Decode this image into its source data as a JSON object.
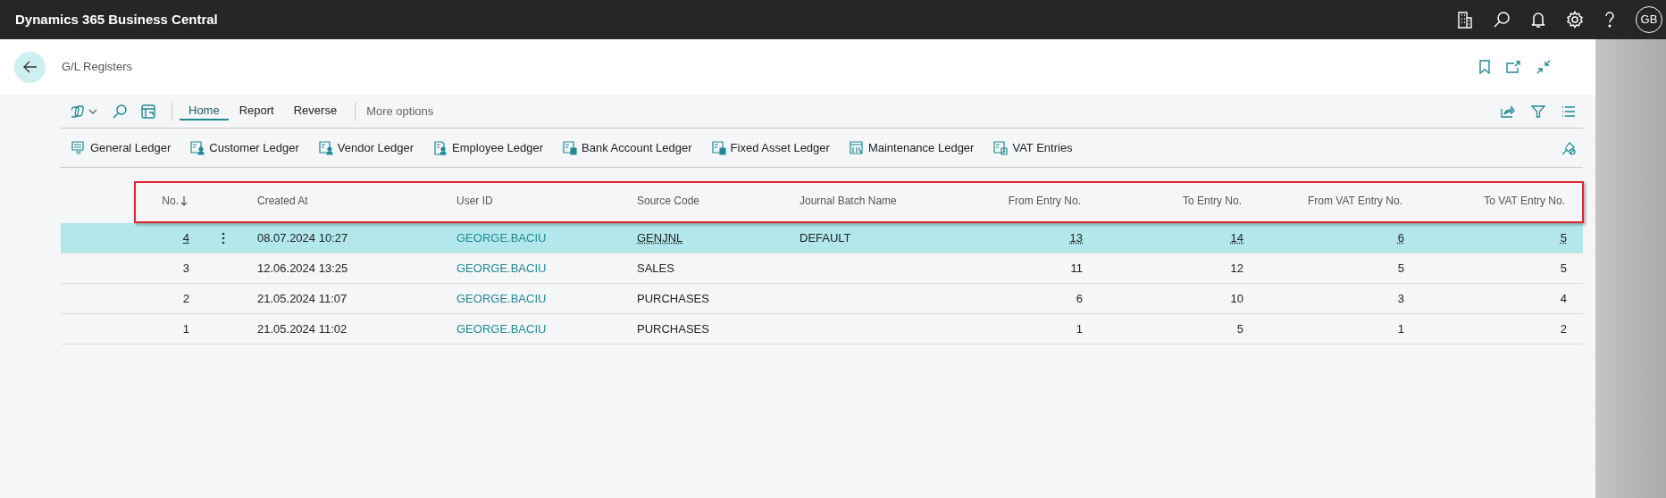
{
  "app": {
    "title": "Dynamics 365 Business Central",
    "avatar": "GB"
  },
  "page": {
    "title": "G/L Registers"
  },
  "action_tabs": [
    {
      "label": "Home",
      "selected": true
    },
    {
      "label": "Report",
      "selected": false
    },
    {
      "label": "Reverse",
      "selected": false
    }
  ],
  "more_options": "More options",
  "actions": [
    "General Ledger",
    "Customer Ledger",
    "Vendor Ledger",
    "Employee Ledger",
    "Bank Account Ledger",
    "Fixed Asset Ledger",
    "Maintenance Ledger",
    "VAT Entries"
  ],
  "table": {
    "columns": [
      {
        "label": "No.",
        "kind": "number",
        "sorted": true
      },
      {
        "label": "Created At",
        "kind": "text",
        "sorted": false
      },
      {
        "label": "User ID",
        "kind": "link",
        "sorted": false
      },
      {
        "label": "Source Code",
        "kind": "code",
        "sorted": false
      },
      {
        "label": "Journal Batch Name",
        "kind": "text",
        "sorted": false
      },
      {
        "label": "From Entry No.",
        "kind": "number",
        "sorted": false
      },
      {
        "label": "To Entry No.",
        "kind": "number",
        "sorted": false
      },
      {
        "label": "From VAT Entry No.",
        "kind": "number",
        "sorted": false
      },
      {
        "label": "To VAT Entry No.",
        "kind": "number",
        "sorted": false
      }
    ],
    "rows": [
      {
        "selected": true,
        "cells": [
          "4",
          "08.07.2024 10:27",
          "GEORGE.BACIU",
          "GENJNL",
          "DEFAULT",
          "13",
          "14",
          "6",
          "5"
        ]
      },
      {
        "selected": false,
        "cells": [
          "3",
          "12.06.2024 13:25",
          "GEORGE.BACIU",
          "SALES",
          null,
          "11",
          "12",
          "5",
          "5"
        ]
      },
      {
        "selected": false,
        "cells": [
          "2",
          "21.05.2024 11:07",
          "GEORGE.BACIU",
          "PURCHASES",
          null,
          "6",
          "10",
          "3",
          "4"
        ]
      },
      {
        "selected": false,
        "cells": [
          "1",
          "21.05.2024 11:02",
          "GEORGE.BACIU",
          "PURCHASES",
          null,
          "1",
          "5",
          "1",
          "2"
        ]
      }
    ]
  }
}
